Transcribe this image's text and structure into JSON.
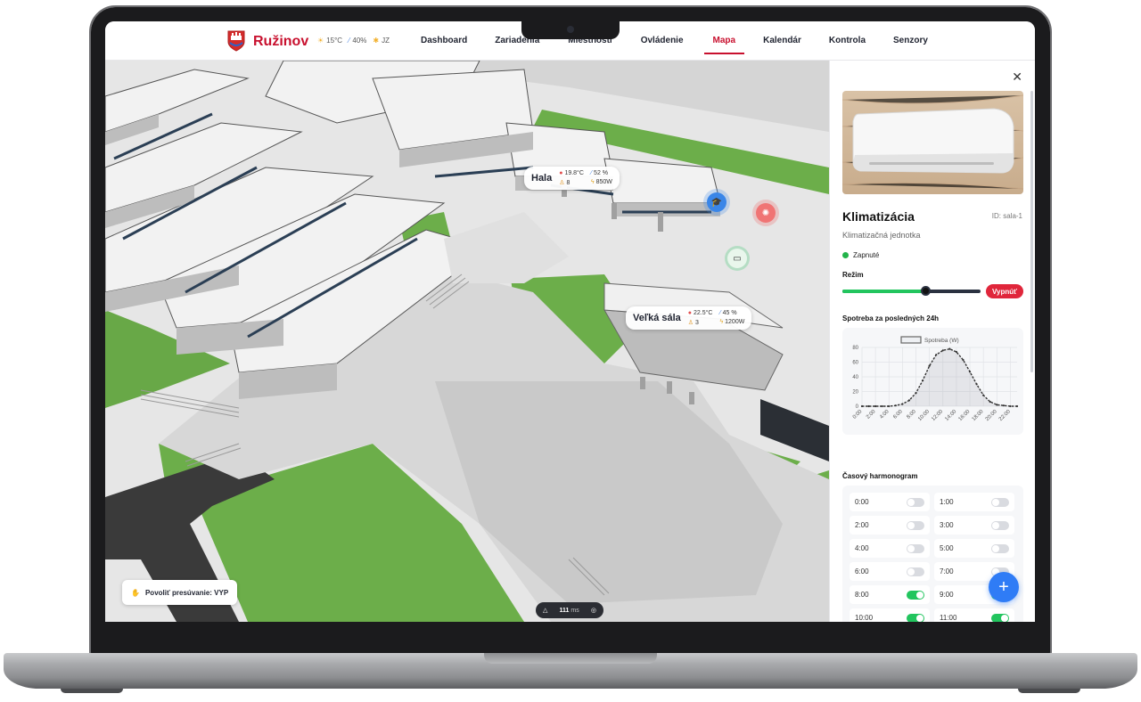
{
  "app": {
    "brand": "Ružinov",
    "weather": {
      "temp": "15°C",
      "humidity": "40%",
      "wind": "JZ"
    },
    "nav": [
      "Dashboard",
      "Zariadenia",
      "Miestnosti",
      "Ovládenie",
      "Mapa",
      "Kalendár",
      "Kontrola",
      "Senzory"
    ],
    "active_nav": "Mapa"
  },
  "map": {
    "rooms": [
      {
        "name": "Hala",
        "temp": "19.8°C",
        "humidity": "52 %",
        "people": "8",
        "power": "850W"
      },
      {
        "name": "Veľká sála",
        "temp": "22.5°C",
        "humidity": "45 %",
        "people": "3",
        "power": "1200W"
      }
    ],
    "pan_toggle": "Povoliť presúvanie: VYP",
    "perf_readout": "111",
    "perf_unit": "ms"
  },
  "panel": {
    "title": "Klimatizácia",
    "id": "ID: sala-1",
    "subtitle": "Klimatizačná jednotka",
    "status": "Zapnuté",
    "mode_label": "Režim",
    "mode_level": 0.6,
    "off_button": "Vypnúť",
    "consumption_label": "Spotreba za posledných 24h",
    "schedule_label": "Časový harmonogram",
    "schedule": [
      {
        "time": "0:00",
        "on": false
      },
      {
        "time": "1:00",
        "on": false
      },
      {
        "time": "2:00",
        "on": false
      },
      {
        "time": "3:00",
        "on": false
      },
      {
        "time": "4:00",
        "on": false
      },
      {
        "time": "5:00",
        "on": false
      },
      {
        "time": "6:00",
        "on": false
      },
      {
        "time": "7:00",
        "on": false
      },
      {
        "time": "8:00",
        "on": true
      },
      {
        "time": "9:00",
        "on": true
      },
      {
        "time": "10:00",
        "on": true
      },
      {
        "time": "11:00",
        "on": true
      }
    ],
    "add_button": "+"
  },
  "chart_data": {
    "type": "line",
    "legend": "Spotreba (W)",
    "x": [
      "0:00",
      "1:00",
      "2:00",
      "3:00",
      "4:00",
      "5:00",
      "6:00",
      "7:00",
      "8:00",
      "9:00",
      "10:00",
      "11:00",
      "12:00",
      "13:00",
      "14:00",
      "15:00",
      "16:00",
      "17:00",
      "18:00",
      "19:00",
      "20:00",
      "21:00",
      "22:00",
      "23:00"
    ],
    "x_ticks": [
      "0:00",
      "2:00",
      "4:00",
      "6:00",
      "8:00",
      "10:00",
      "12:00",
      "14:00",
      "16:00",
      "18:00",
      "20:00",
      "22:00"
    ],
    "series": [
      {
        "name": "Spotreba (W)",
        "values": [
          0,
          0,
          0,
          0,
          0,
          1,
          3,
          8,
          18,
          35,
          55,
          70,
          76,
          78,
          74,
          63,
          47,
          30,
          15,
          6,
          2,
          1,
          0,
          0
        ]
      }
    ],
    "ylim": [
      0,
      80
    ],
    "y_ticks": [
      0,
      20,
      40,
      60,
      80
    ],
    "grid": true
  }
}
